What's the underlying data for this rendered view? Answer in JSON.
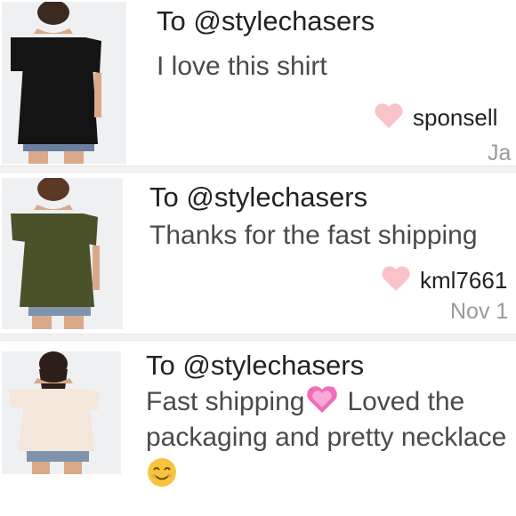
{
  "comments": [
    {
      "to": "To @stylechasers",
      "message": "I love this shirt",
      "username": "sponsell",
      "date": "Ja",
      "shirt_color": "#141414"
    },
    {
      "to": "To @stylechasers",
      "message": "Thanks for the fast shipping",
      "username": "kml7661",
      "date": "Nov 1",
      "shirt_color": "#4b5128"
    },
    {
      "to": "To @stylechasers",
      "message_part1": "Fast shipping",
      "message_part2": "Loved the",
      "message_line2": "packaging and pretty necklace",
      "shirt_color": "#f3e7dc"
    }
  ],
  "colors": {
    "heart": "#f9c3c9",
    "sparkle_heart": "#f06cb8",
    "smiley": "#f7c53c"
  },
  "icons": [
    "heart-icon",
    "sparkling-heart-emoji",
    "smiling-face-emoji"
  ]
}
